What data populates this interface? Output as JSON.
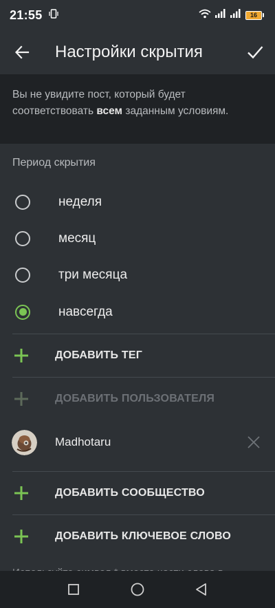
{
  "status_bar": {
    "time": "21:55",
    "battery_level": "16",
    "icons": [
      "vibrate-icon",
      "wifi-icon",
      "signal-icon",
      "signal-icon",
      "battery-icon"
    ]
  },
  "app_bar": {
    "title": "Настройки скрытия",
    "back_icon": "arrow-left-icon",
    "confirm_icon": "check-icon"
  },
  "info": {
    "text_before": "Вы не увидите пост, который будет соответствовать ",
    "text_bold": "всем",
    "text_after": " заданным условиям."
  },
  "period": {
    "title": "Период скрытия",
    "options": [
      {
        "label": "неделя",
        "selected": false
      },
      {
        "label": "месяц",
        "selected": false
      },
      {
        "label": "три месяца",
        "selected": false
      },
      {
        "label": "навсегда",
        "selected": true
      }
    ]
  },
  "actions": {
    "add_tag": "ДОБАВИТЬ ТЕГ",
    "add_user": "ДОБАВИТЬ ПОЛЬЗОВАТЕЛЯ",
    "add_community": "ДОБАВИТЬ СООБЩЕСТВО",
    "add_keyword": "ДОБАВИТЬ КЛЮЧЕВОЕ СЛОВО"
  },
  "user": {
    "name": "Madhotaru"
  },
  "hint": {
    "text": "Используйте символ * вместо части слова в"
  },
  "colors": {
    "accent": "#7bc454",
    "background": "#2d3135",
    "info_background": "#1f2225",
    "nav_background": "#1e2124"
  }
}
